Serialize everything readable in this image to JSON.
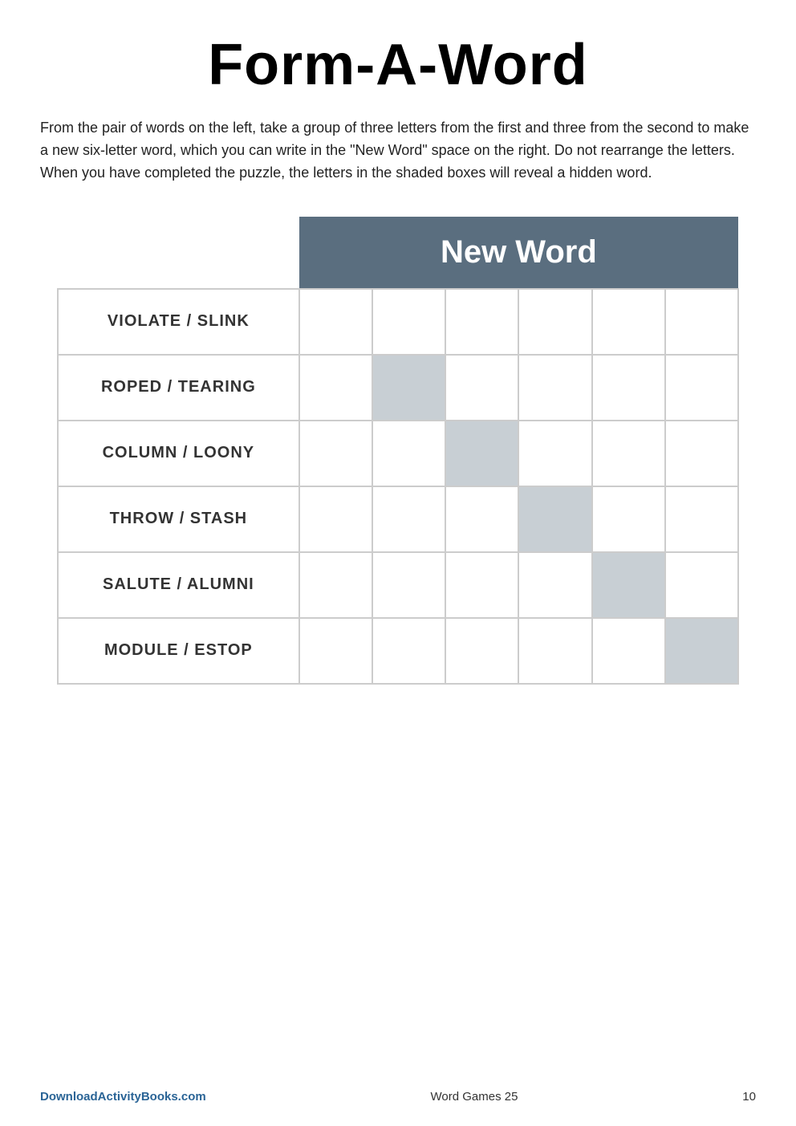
{
  "page": {
    "title": "Form-A-Word",
    "instructions": "From the pair of words on the left, take a group of three letters from the first and three from the second to make a new six-letter word, which you can write in the \"New Word\" space on the right. Do not rearrange the letters. When you have completed the puzzle, the letters in the shaded boxes will reveal a hidden word.",
    "new_word_header": "New Word",
    "rows": [
      {
        "word_pair": "VIOLATE / SLINK",
        "cells": [
          "white",
          "white",
          "white",
          "white",
          "white",
          "white"
        ]
      },
      {
        "word_pair": "ROPED / TEARING",
        "cells": [
          "white",
          "shaded",
          "white",
          "white",
          "white",
          "white"
        ]
      },
      {
        "word_pair": "COLUMN / LOONY",
        "cells": [
          "white",
          "white",
          "shaded",
          "white",
          "white",
          "white"
        ]
      },
      {
        "word_pair": "THROW / STASH",
        "cells": [
          "white",
          "white",
          "white",
          "shaded",
          "white",
          "white"
        ]
      },
      {
        "word_pair": "SALUTE / ALUMNI",
        "cells": [
          "white",
          "white",
          "white",
          "white",
          "shaded",
          "white"
        ]
      },
      {
        "word_pair": "MODULE / ESTOP",
        "cells": [
          "white",
          "white",
          "white",
          "white",
          "white",
          "shaded"
        ]
      }
    ],
    "footer": {
      "left": "DownloadActivityBooks.com",
      "center": "Word Games 25",
      "right": "10"
    }
  }
}
